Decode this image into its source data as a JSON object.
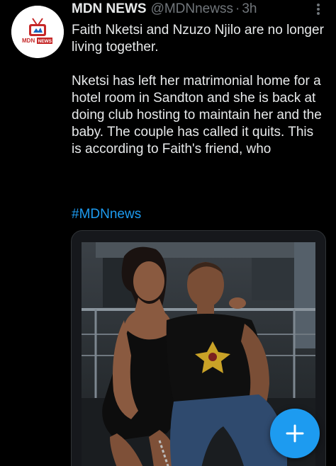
{
  "account": {
    "display_name": "MDN NEWS",
    "handle": "@MDNnewss",
    "separator": "·",
    "time": "3h",
    "avatar_logo_text": "MDN NEWS"
  },
  "tweet": {
    "paragraph_1": "Faith Nketsi and Nzuzo Njilo are no longer living together.",
    "paragraph_2": "Nketsi has left her matrimonial home for a hotel room in Sandton and she is back at doing club hosting to maintain her and the baby. The couple has called it quits. This is according to Faith's friend, who",
    "hashtag": "#MDNnews"
  },
  "media": {
    "description_icon": "photo-of-couple"
  },
  "fab": {
    "icon": "plus-icon"
  },
  "colors": {
    "background": "#000000",
    "text_primary": "#e7e9ea",
    "text_secondary": "#71767b",
    "accent": "#1d9bf0",
    "logo_red": "#d32f2f"
  }
}
